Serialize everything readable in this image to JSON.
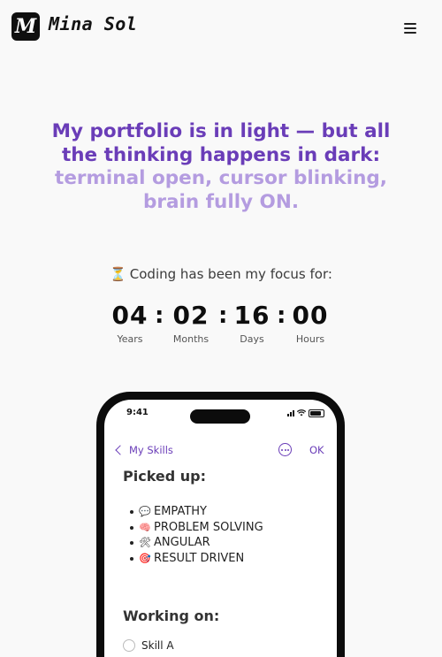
{
  "brand": {
    "logo_letter": "M",
    "name": "Mina Sol"
  },
  "header": {
    "menu_icon": "hamburger-icon"
  },
  "hero": {
    "line1": "My portfolio is in light — but all",
    "line2": "the thinking happens in dark:",
    "line3": "terminal open, cursor blinking,",
    "line4": "brain fully ON.",
    "colors": {
      "dark": "#6a3db8",
      "light": "#b49ce0"
    }
  },
  "focus": {
    "icon": "⏳",
    "text": "Coding has been my focus for:"
  },
  "counter": {
    "separator": ":",
    "units": [
      {
        "value": "04",
        "label": "Years"
      },
      {
        "value": "02",
        "label": "Months"
      },
      {
        "value": "16",
        "label": "Days"
      },
      {
        "value": "00",
        "label": "Hours"
      }
    ]
  },
  "phone": {
    "time": "9:41",
    "nav": {
      "back_label": "My Skills",
      "ok_label": "OK"
    },
    "picked_up": {
      "title": "Picked up:",
      "items": [
        {
          "icon": "💬",
          "label": "EMPATHY"
        },
        {
          "icon": "🧠",
          "label": "PROBLEM SOLVING"
        },
        {
          "icon": "🛠",
          "label": "ANGULAR"
        },
        {
          "icon": "🎯",
          "label": "RESULT DRIVEN"
        }
      ]
    },
    "working_on": {
      "title": "Working on:",
      "items": [
        {
          "label": "Skill A"
        }
      ]
    }
  }
}
